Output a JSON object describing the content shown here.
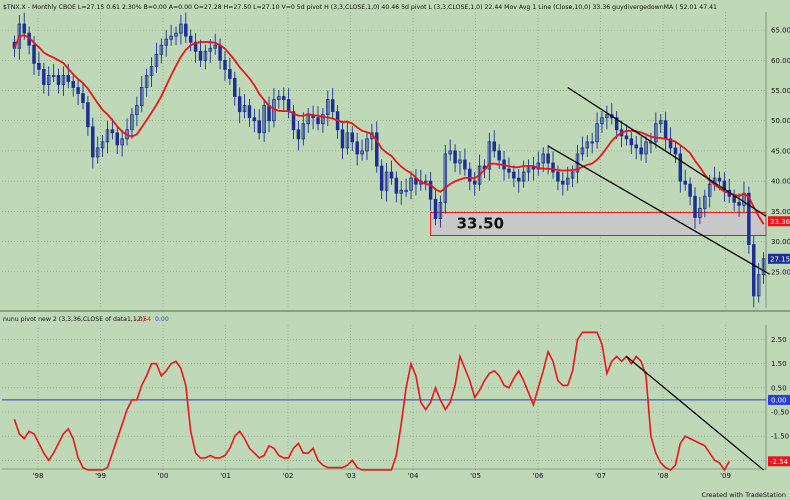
{
  "colors": {
    "background": "#bfd9b8",
    "candle_up": "#1c2f95",
    "candle_down": "#1c2f95",
    "moving_average": "#e8151c",
    "oscillator": "#e8151c",
    "zero_line": "#2b3cd8",
    "trend_lines": "#000000",
    "support_zone_fill": "#c8c8c8",
    "support_zone_border": "#e8151c",
    "grid": "#7a9a74"
  },
  "price_panel": {
    "header": "$TNX.X - Monthly  CBOE  L=27.15  0.61  2.30%  B=0.00  A=0.00  O=27.28  H=27.50  L=27.10  V=0  5d pivot H (3,3,CLOSE,1,0)  40.46  5d pivot L (3,3,CLOSE,1,0)  22.44  Mov Avg 1 Line (Close,10,0)  33.36  guydivergedownMA (  52.01  47.41",
    "support_label": "33.50"
  },
  "oscillator_panel": {
    "header_name": "nunu pivot new 2 (3,3,36,CLOSE of data1,1,0)",
    "header_value": "-2.54",
    "header_zero": "0.00"
  },
  "footer": "Created with TradeStation",
  "chart_data": [
    {
      "type": "candlestick",
      "title": "$TNX.X - Monthly",
      "y_ticks": [
        25.0,
        30.0,
        35.0,
        40.0,
        45.0,
        50.0,
        55.0,
        60.0,
        65.0
      ],
      "ylim": [
        19.0,
        68.0
      ],
      "x_tick_labels": [
        "'98",
        "'99",
        "'00",
        "'01",
        "'02",
        "'03",
        "'04",
        "'05",
        "'06",
        "'07",
        "'08",
        "'09"
      ],
      "value_flags": [
        {
          "label": "33.36",
          "value": 33.36,
          "color": "#e8151c"
        },
        {
          "label": "27.15",
          "value": 27.15,
          "color": "#1c2f95"
        }
      ],
      "support_zone": [
        31.0,
        34.8
      ],
      "close_series": [
        62.0,
        66.0,
        64.5,
        62.5,
        59.5,
        58.5,
        56.0,
        57.5,
        57.5,
        56.0,
        57.5,
        56.5,
        55.5,
        54.5,
        53.0,
        49.0,
        44.0,
        45.5,
        46.5,
        48.5,
        48.0,
        46.0,
        47.0,
        48.5,
        51.0,
        52.5,
        55.5,
        57.5,
        59.0,
        61.0,
        62.5,
        63.5,
        64.0,
        64.5,
        66.0,
        64.0,
        63.0,
        61.5,
        60.0,
        61.5,
        62.0,
        62.5,
        60.0,
        58.5,
        57.0,
        54.0,
        51.5,
        52.5,
        50.5,
        50.0,
        48.0,
        52.5,
        50.0,
        53.5,
        54.0,
        53.5,
        51.5,
        48.5,
        47.0,
        49.5,
        51.0,
        50.5,
        49.5,
        51.0,
        53.5,
        51.5,
        48.5,
        45.5,
        48.0,
        46.5,
        44.5,
        45.0,
        47.0,
        48.0,
        42.5,
        38.5,
        41.5,
        40.5,
        38.0,
        38.5,
        38.5,
        40.5,
        39.5,
        40.0,
        40.0,
        37.0,
        33.8,
        36.5,
        44.5,
        45.0,
        43.0,
        43.5,
        42.0,
        40.0,
        39.5,
        42.5,
        42.0,
        46.5,
        45.0,
        43.5,
        42.0,
        41.5,
        40.5,
        40.0,
        41.5,
        42.5,
        42.0,
        43.0,
        44.5,
        43.0,
        41.5,
        40.0,
        39.5,
        40.5,
        41.5,
        44.5,
        45.5,
        46.5,
        46.5,
        49.5,
        50.5,
        51.0,
        50.5,
        48.5,
        47.5,
        47.0,
        46.0,
        45.5,
        44.5,
        46.5,
        46.5,
        49.5,
        50.0,
        47.0,
        45.5,
        44.5,
        40.0,
        39.5,
        37.5,
        34.0,
        35.5,
        37.5,
        39.5,
        40.5,
        40.0,
        38.5,
        37.5,
        36.5,
        36.0,
        38.0,
        29.5,
        21.0,
        24.5,
        27.15
      ]
    },
    {
      "type": "line",
      "title": "nunu pivot new 2 (3,3,36,CLOSE of data1,1,0)",
      "y_ticks": [
        2.5,
        1.5,
        0.5,
        -0.5,
        -1.5,
        -2.5
      ],
      "zero_line": 0.0,
      "ylim": [
        -2.9,
        3.1
      ],
      "last_value": -2.54,
      "series": [
        -0.8,
        -1.4,
        -1.6,
        -1.3,
        -1.4,
        -1.8,
        -2.2,
        -2.5,
        -2.2,
        -1.8,
        -1.4,
        -1.2,
        -1.6,
        -2.4,
        -2.8,
        -2.9,
        -2.9,
        -2.9,
        -2.9,
        -2.8,
        -2.2,
        -1.6,
        -1.0,
        -0.4,
        0.0,
        0.0,
        0.6,
        1.0,
        1.5,
        1.5,
        1.0,
        1.2,
        1.5,
        1.6,
        1.3,
        0.6,
        -1.3,
        -2.2,
        -2.4,
        -2.4,
        -2.3,
        -2.4,
        -2.4,
        -2.3,
        -2.0,
        -1.5,
        -1.3,
        -1.6,
        -2.0,
        -2.2,
        -2.4,
        -2.3,
        -1.9,
        -2.0,
        -2.3,
        -2.4,
        -2.4,
        -2.0,
        -1.8,
        -2.2,
        -2.2,
        -2.0,
        -2.5,
        -2.7,
        -2.8,
        -2.8,
        -2.8,
        -2.8,
        -2.7,
        -2.5,
        -2.8,
        -2.9,
        -2.9,
        -2.9,
        -2.9,
        -2.9,
        -2.9,
        -2.9,
        -2.3,
        -1.0,
        0.5,
        1.5,
        1.0,
        -0.1,
        -0.4,
        -0.1,
        0.5,
        0.0,
        -0.4,
        -0.1,
        0.6,
        1.8,
        1.3,
        0.8,
        0.1,
        0.4,
        0.8,
        1.1,
        1.2,
        1.0,
        0.6,
        0.5,
        0.9,
        1.2,
        0.8,
        0.3,
        -0.2,
        0.5,
        1.2,
        2.0,
        1.6,
        0.8,
        0.6,
        0.6,
        1.2,
        2.5,
        2.8,
        2.8,
        2.8,
        2.8,
        2.3,
        1.1,
        1.6,
        1.8,
        1.6,
        1.8,
        1.5,
        1.8,
        1.6,
        1.0,
        -1.5,
        -2.2,
        -2.6,
        -2.8,
        -2.9,
        -2.7,
        -1.8,
        -1.5,
        -1.6,
        -1.7,
        -1.8,
        -1.9,
        -2.2,
        -2.5,
        -2.6,
        -2.9,
        -2.54
      ]
    }
  ]
}
